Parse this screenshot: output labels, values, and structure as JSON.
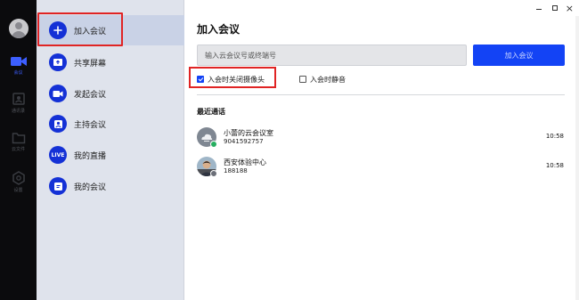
{
  "colors": {
    "accent": "#1343f5",
    "menu_icon": "#1431d6",
    "highlight": "#e02424",
    "rail_bg": "#0b0b0d",
    "sidebar_bg": "#dfe3ec"
  },
  "rail": {
    "avatar_icon": "user-avatar-icon",
    "items": [
      {
        "icon": "video-camera-icon",
        "label": "会议"
      },
      {
        "icon": "contacts-icon",
        "label": "通讯录"
      },
      {
        "icon": "folder-icon",
        "label": "云文件"
      },
      {
        "icon": "settings-icon",
        "label": "设置"
      }
    ]
  },
  "menu": {
    "items": [
      {
        "icon": "plus-icon",
        "label": "加入会议"
      },
      {
        "icon": "share-screen-icon",
        "label": "共享屏幕"
      },
      {
        "icon": "video-icon",
        "label": "发起会议"
      },
      {
        "icon": "host-icon",
        "label": "主持会议"
      },
      {
        "icon": "live-icon",
        "icon_text": "LIVE",
        "label": "我的直播"
      },
      {
        "icon": "my-meeting-icon",
        "label": "我的会议"
      }
    ]
  },
  "window": {
    "minimize": "minimize-icon",
    "maximize": "maximize-icon",
    "close": "×"
  },
  "main": {
    "title": "加入会议",
    "input_placeholder": "输入云会议号或终端号",
    "join_button": "加入会议",
    "camera_off_label": "入会时关闭摄像头",
    "camera_off_checked": true,
    "mute_label": "入会时静音",
    "mute_checked": false,
    "recent_title": "最近通话",
    "calls": [
      {
        "name": "小蕾的云会议室",
        "number": "9041592757",
        "time": "10:58",
        "avatar": "cloud-room-icon",
        "badge_color": "#27ae60"
      },
      {
        "name": "西安体验中心",
        "number": "188188",
        "time": "10:58",
        "avatar": "person-photo",
        "badge_color": "#6b6f78"
      }
    ]
  }
}
